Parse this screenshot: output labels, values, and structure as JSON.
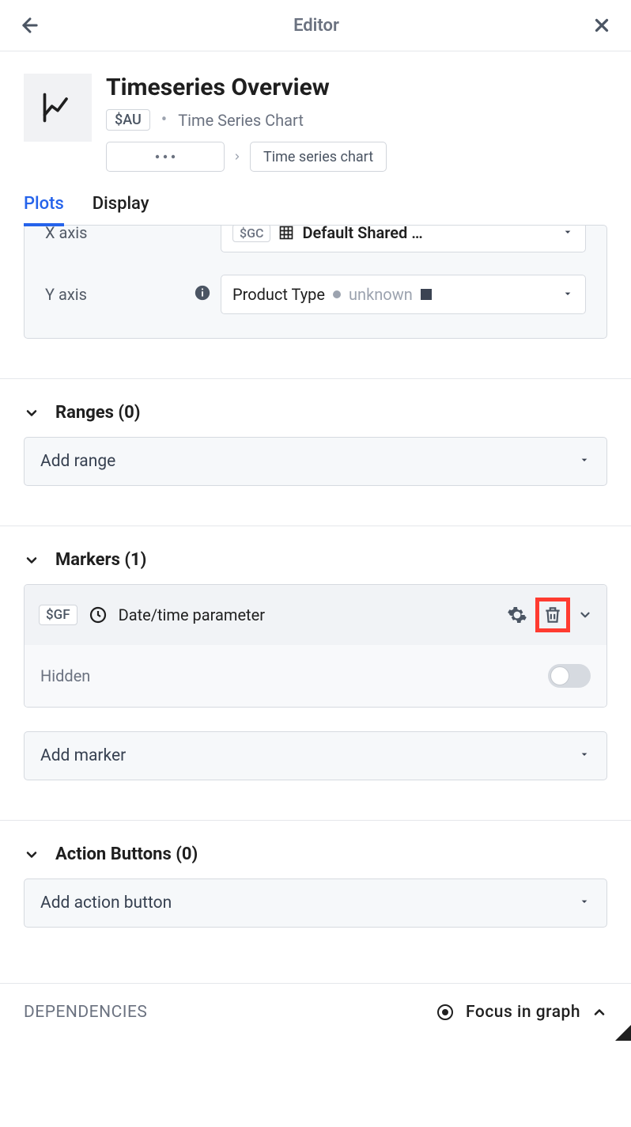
{
  "header": {
    "title": "Editor"
  },
  "chart": {
    "title": "Timeseries Overview",
    "tag": "$AU",
    "type_label": "Time Series Chart",
    "breadcrumb_last": "Time series chart"
  },
  "tabs": {
    "plots": "Plots",
    "display": "Display"
  },
  "axes": {
    "x_label": "X axis",
    "x_tag": "$GC",
    "x_value": "Default Shared …",
    "y_label": "Y axis",
    "y_value": "Product Type",
    "y_unknown": "unknown"
  },
  "ranges": {
    "header": "Ranges (0)",
    "add": "Add range"
  },
  "markers": {
    "header": "Markers (1)",
    "item_tag": "$GF",
    "item_label": "Date/time parameter",
    "hidden_label": "Hidden",
    "add": "Add marker"
  },
  "actions": {
    "header": "Action Buttons (0)",
    "add": "Add action button"
  },
  "footer": {
    "deps": "DEPENDENCIES",
    "focus": "Focus in graph"
  }
}
